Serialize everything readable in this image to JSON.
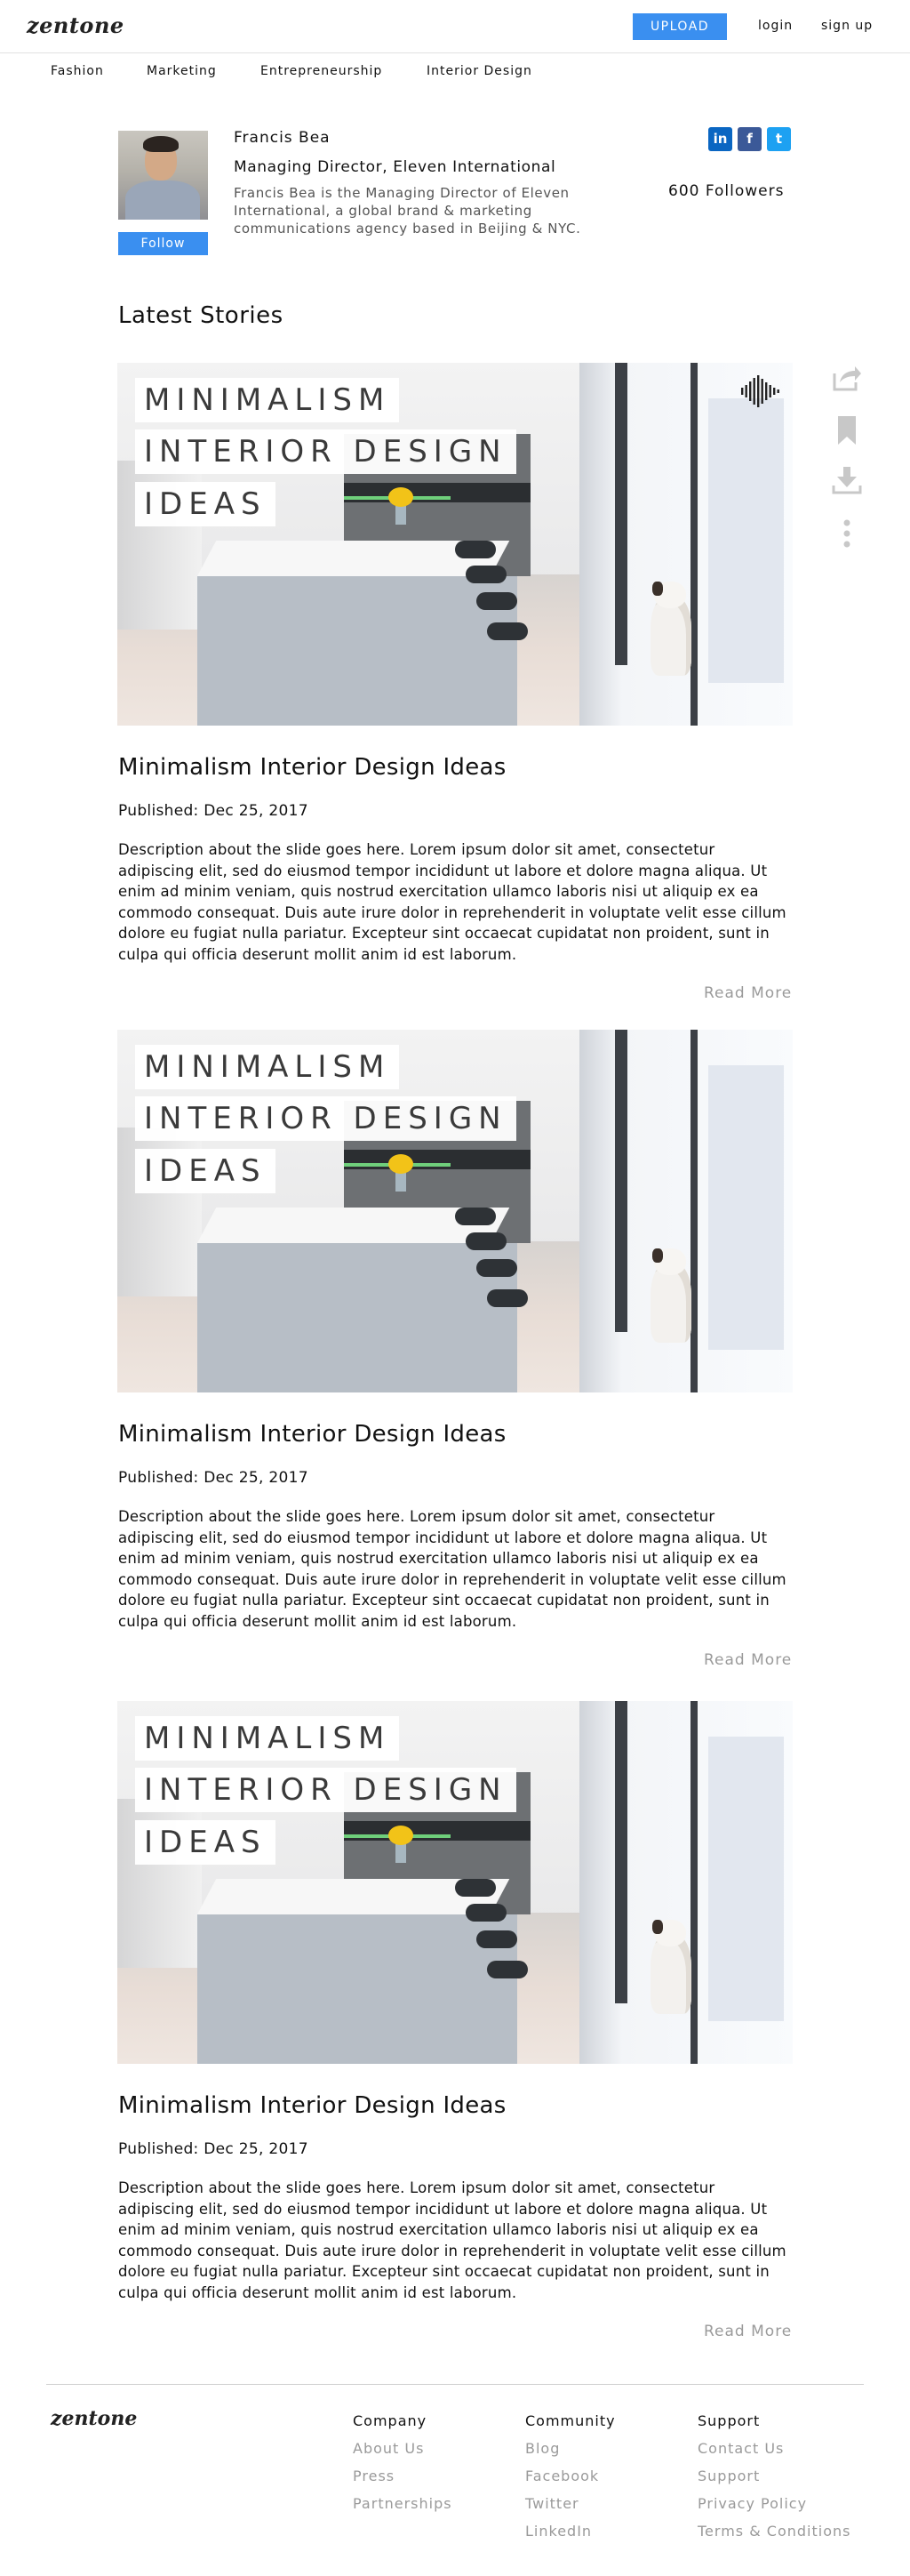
{
  "header": {
    "logo": "zentone",
    "upload_label": "UPLOAD",
    "login_label": "login",
    "signup_label": "sign up"
  },
  "categories": [
    "Fashion",
    "Marketing",
    "Entrepreneurship",
    "Interior Design"
  ],
  "profile": {
    "name": "Francis Bea",
    "title": "Managing Director, Eleven International",
    "bio": "Francis Bea is the Managing Director of Eleven International, a global brand & marketing communications agency based in Beijing & NYC.",
    "follow_label": "Follow",
    "followers": "600 Followers",
    "socials": [
      {
        "icon": "linkedin-icon",
        "glyph": "in",
        "color": "#0a66c2"
      },
      {
        "icon": "facebook-icon",
        "glyph": "f",
        "color": "#3b5998"
      },
      {
        "icon": "twitter-icon",
        "glyph": "t",
        "color": "#1da1f2"
      }
    ]
  },
  "section_title": "Latest Stories",
  "side_actions": [
    "share-icon",
    "bookmark-icon",
    "download-icon",
    "more-vertical-icon"
  ],
  "stories": [
    {
      "image_lines": [
        "MINIMALISM",
        "INTERIOR DESIGN",
        "IDEAS"
      ],
      "title": "Minimalism Interior Design Ideas",
      "published": "Published: Dec 25, 2017",
      "description": "Description about the slide goes here. Lorem ipsum dolor sit amet, consectetur adipiscing elit, sed do eiusmod tempor incididunt ut labore et dolore magna aliqua. Ut enim ad minim veniam, quis nostrud exercitation ullamco laboris nisi ut aliquip ex ea commodo consequat. Duis aute irure dolor in reprehenderit in voluptate velit esse cillum dolore eu fugiat nulla pariatur. Excepteur sint occaecat cupidatat non proident, sunt in culpa qui officia deserunt mollit anim id est laborum.",
      "read_more": "Read More"
    },
    {
      "image_lines": [
        "MINIMALISM",
        "INTERIOR DESIGN",
        "IDEAS"
      ],
      "title": "Minimalism Interior Design Ideas",
      "published": "Published: Dec 25, 2017",
      "description": "Description about the slide goes here. Lorem ipsum dolor sit amet, consectetur adipiscing elit, sed do eiusmod tempor incididunt ut labore et dolore magna aliqua. Ut enim ad minim veniam, quis nostrud exercitation ullamco laboris nisi ut aliquip ex ea commodo consequat. Duis aute irure dolor in reprehenderit in voluptate velit esse cillum dolore eu fugiat nulla pariatur. Excepteur sint occaecat cupidatat non proident, sunt in culpa qui officia deserunt mollit anim id est laborum.",
      "read_more": "Read More"
    },
    {
      "image_lines": [
        "MINIMALISM",
        "INTERIOR DESIGN",
        "IDEAS"
      ],
      "title": "Minimalism Interior Design Ideas",
      "published": "Published: Dec 25, 2017",
      "description": "Description about the slide goes here. Lorem ipsum dolor sit amet, consectetur adipiscing elit, sed do eiusmod tempor incididunt ut labore et dolore magna aliqua. Ut enim ad minim veniam, quis nostrud exercitation ullamco laboris nisi ut aliquip ex ea commodo consequat. Duis aute irure dolor in reprehenderit in voluptate velit esse cillum dolore eu fugiat nulla pariatur. Excepteur sint occaecat cupidatat non proident, sunt in culpa qui officia deserunt mollit anim id est laborum.",
      "read_more": "Read More"
    }
  ],
  "footer": {
    "logo": "zentone",
    "columns": [
      {
        "heading": "Company",
        "links": [
          "About Us",
          "Press",
          "Partnerships"
        ]
      },
      {
        "heading": "Community",
        "links": [
          "Blog",
          "Facebook",
          "Twitter",
          "LinkedIn"
        ]
      },
      {
        "heading": "Support",
        "links": [
          "Contact Us",
          "Support",
          "Privacy Policy",
          "Terms & Conditions"
        ]
      }
    ]
  }
}
